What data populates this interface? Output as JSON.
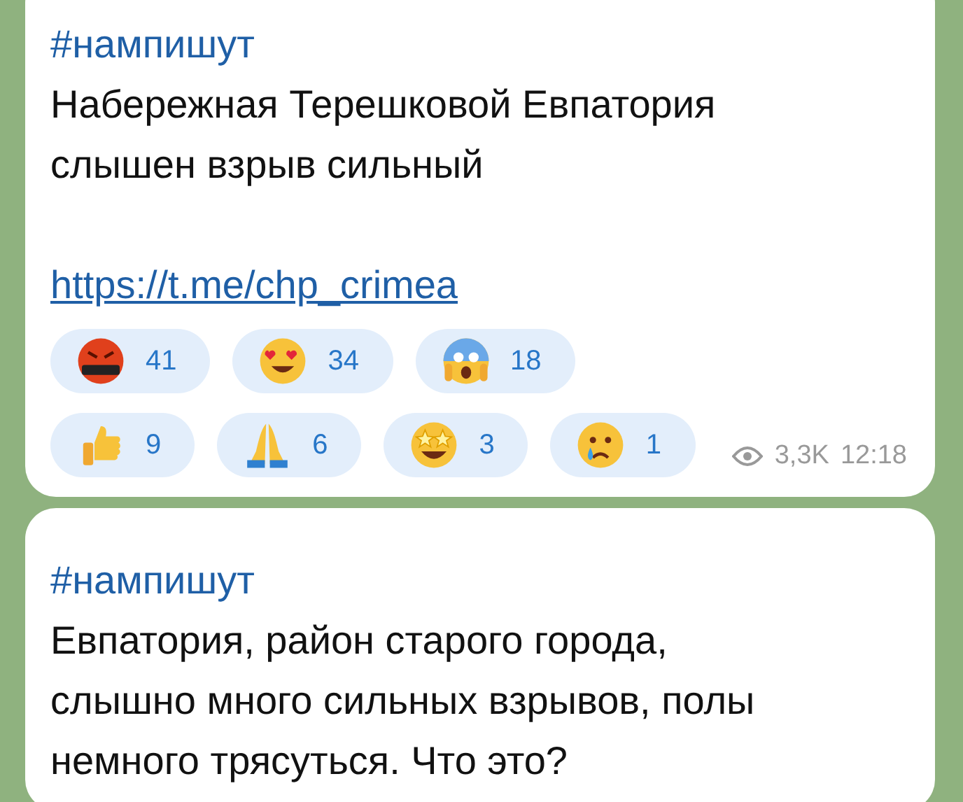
{
  "messages": [
    {
      "hashtag": "#нампишут",
      "lines": [
        "Набережная Терешковой Евпатория",
        "слышен взрыв сильный"
      ],
      "link": "https://t.me/chp_crimea",
      "reactions": [
        {
          "kind": "cursing",
          "count": "41"
        },
        {
          "kind": "heart-eyes",
          "count": "34"
        },
        {
          "kind": "scream",
          "count": "18"
        },
        {
          "kind": "thumbs-up",
          "count": "9"
        },
        {
          "kind": "pray",
          "count": "6"
        },
        {
          "kind": "star-struck",
          "count": "3"
        },
        {
          "kind": "crying",
          "count": "1"
        }
      ],
      "views": "3,3K",
      "time": "12:18"
    },
    {
      "hashtag": "#нампишут",
      "lines": [
        "Евпатория, район старого города,",
        "слышно много сильных взрывов, полы",
        "немного трясуться. Что это?"
      ]
    }
  ]
}
